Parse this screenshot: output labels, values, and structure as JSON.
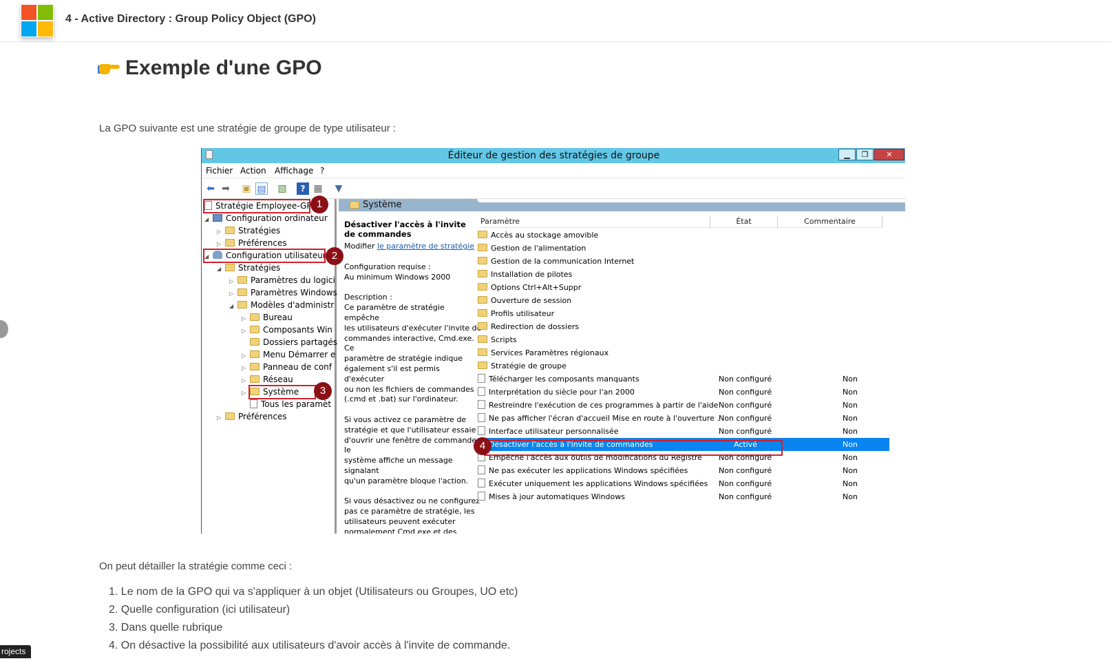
{
  "header": {
    "title": "4 - Active Directory : Group Policy Object (GPO)"
  },
  "article": {
    "heading": "Exemple d'une GPO",
    "intro": "La GPO suivante est une stratégie de groupe de type utilisateur :",
    "detail_intro": "On peut détailler la stratégie comme ceci :",
    "steps": [
      "1. Le nom de la GPO qui va s'appliquer à un objet (Utilisateurs ou Groupes, UO etc)",
      "2. Quelle configuration (ici utilisateur)",
      "3. Dans quelle rubrique",
      "4. On désactive la possibilité aux utilisateurs d'avoir accès à l'invite de commande."
    ]
  },
  "footer_badge": "rojects",
  "window": {
    "title": "Éditeur de gestion des stratégies de groupe",
    "controls": {
      "minimize": "▁",
      "maximize": "❐",
      "close": "✕"
    },
    "menu": [
      "Fichier",
      "Action",
      "Affichage",
      "?"
    ],
    "tree": [
      "Stratégie Employee-GPO",
      "Configuration ordinateur",
      "Stratégies",
      "Préférences",
      "Configuration utilisateur",
      "Stratégies",
      "Paramètres du logici",
      "Paramètres Windows",
      "Modèles d'administr",
      "Bureau",
      "Composants Win",
      "Dossiers partagés",
      "Menu Démarrer e",
      "Panneau de conf",
      "Réseau",
      "Système",
      "Tous les paramèt",
      "Préférences"
    ],
    "panel_title": "Système",
    "detail": {
      "title": "Désactiver l'accès à l'invite de commandes",
      "edit_prefix": "Modifier ",
      "edit_link": "le paramètre de stratégie",
      "body": "Configuration requise :\nAu minimum Windows 2000\n\nDescription :\nCe paramètre de stratégie empêche\nles utilisateurs d'exécuter l'invite de\ncommandes interactive, Cmd.exe.  Ce\nparamètre de stratégie indique\négalement s'il est permis d'exécuter\nou non les fichiers de commandes\n(.cmd et .bat) sur l'ordinateur.\n\nSi vous activez ce paramètre de\nstratégie et que l'utilisateur essaie\nd'ouvrir une fenêtre de commande, le\nsystème affiche un message signalant\nqu'un paramètre bloque l'action.\n\nSi vous désactivez ou ne configurez\npas ce paramètre de stratégie, les\nutilisateurs peuvent exécuter\nnormalement Cmd.exe et des fichiers\nde commandes.\n\nRemarque : n'empêchez pas"
    },
    "columns": [
      "Paramètre",
      "État",
      "Commentaire"
    ],
    "folders": [
      "Accès au stockage amovible",
      "Gestion de l'alimentation",
      "Gestion de la communication Internet",
      "Installation de pilotes",
      "Options Ctrl+Alt+Suppr",
      "Ouverture de session",
      "Profils utilisateur",
      "Redirection de dossiers",
      "Scripts",
      "Services Paramètres régionaux",
      "Stratégie de groupe"
    ],
    "settings": [
      {
        "name": "Télécharger les composants manquants",
        "state": "Non configuré",
        "comment": "Non"
      },
      {
        "name": "Interprétation du siècle pour l'an 2000",
        "state": "Non configuré",
        "comment": "Non"
      },
      {
        "name": "Restreindre l'exécution de ces programmes à partir de l'aide",
        "state": "Non configuré",
        "comment": "Non"
      },
      {
        "name": "Ne pas afficher l'écran d'accueil Mise en route à l'ouverture ...",
        "state": "Non configuré",
        "comment": "Non"
      },
      {
        "name": "Interface utilisateur personnalisée",
        "state": "Non configuré",
        "comment": "Non"
      },
      {
        "name": "Désactiver l'accès à l'invite de commandes",
        "state": "Activé",
        "comment": "Non"
      },
      {
        "name": "Empêche l'accès aux outils de modifications du Registre",
        "state": "Non configuré",
        "comment": "Non"
      },
      {
        "name": "Ne pas exécuter les applications Windows spécifiées",
        "state": "Non configuré",
        "comment": "Non"
      },
      {
        "name": "Exécuter uniquement les applications Windows spécifiées",
        "state": "Non configuré",
        "comment": "Non"
      },
      {
        "name": "Mises à jour automatiques Windows",
        "state": "Non configuré",
        "comment": "Non"
      }
    ],
    "badges": [
      "1",
      "2",
      "3",
      "4"
    ]
  },
  "colors": {
    "titlebar": "#62c7e6",
    "selection": "#0a84f0",
    "highlight": "#d1202a",
    "badge": "#8b1016"
  }
}
